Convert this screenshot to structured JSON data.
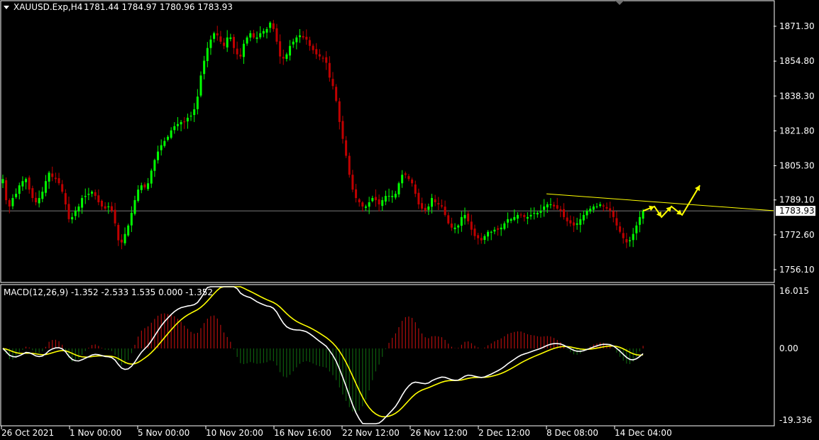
{
  "header": {
    "symbol": "XAUUSD.Exp,H4",
    "ohlc": "1781.44 1784.97 1780.96 1783.93"
  },
  "macd_header": "MACD(12,26,9) -1.352 -2.533 1.535 0.000 -1.352",
  "colors": {
    "background": "#000000",
    "bull": "#00ff00",
    "bear": "#c00000",
    "frame": "#ffffff",
    "trendline": "#ffff00",
    "macd_line": "#ffffff",
    "signal_line": "#ffff00",
    "hist_pos": "#d01010",
    "hist_neg": "#107010",
    "current_price_line": "#a0a0a0"
  },
  "icons": [
    "dropdown-triangle-icon",
    "scroll-marker-icon"
  ],
  "chart_data": [
    {
      "type": "candlestick",
      "title": "XAUUSD.Exp,H4",
      "y_ticks": [
        "1871.30",
        "1854.80",
        "1838.30",
        "1821.80",
        "1805.30",
        "1789.10",
        "1772.60",
        "1756.10"
      ],
      "ylim": [
        1752,
        1880
      ],
      "current_price": "1783.93",
      "x_ticks": [
        "26 Oct 2021",
        "1 Nov 00:00",
        "5 Nov 00:00",
        "10 Nov 20:00",
        "16 Nov 16:00",
        "22 Nov 12:00",
        "26 Nov 12:00",
        "2 Dec 12:00",
        "8 Dec 08:00",
        "14 Dec 04:00"
      ],
      "close_series": [
        1799,
        1789,
        1786,
        1790,
        1792,
        1796,
        1798,
        1799,
        1794,
        1790,
        1788,
        1790,
        1793,
        1798,
        1802,
        1800,
        1799,
        1797,
        1793,
        1787,
        1780,
        1781,
        1784,
        1786,
        1790,
        1791,
        1792,
        1793,
        1791,
        1788,
        1786,
        1785,
        1786,
        1784,
        1778,
        1770,
        1769,
        1773,
        1777,
        1783,
        1789,
        1794,
        1796,
        1795,
        1797,
        1803,
        1808,
        1812,
        1815,
        1817,
        1819,
        1822,
        1824,
        1825,
        1826,
        1826,
        1828,
        1829,
        1832,
        1838,
        1848,
        1855,
        1861,
        1865,
        1868,
        1867,
        1864,
        1862,
        1866,
        1866,
        1861,
        1858,
        1857,
        1863,
        1866,
        1868,
        1866,
        1866,
        1868,
        1869,
        1870,
        1873,
        1870,
        1864,
        1857,
        1856,
        1858,
        1862,
        1864,
        1866,
        1867,
        1866,
        1865,
        1862,
        1860,
        1858,
        1857,
        1856,
        1854,
        1847,
        1843,
        1836,
        1826,
        1818,
        1810,
        1801,
        1794,
        1790,
        1788,
        1786,
        1786,
        1788,
        1790,
        1789,
        1787,
        1789,
        1791,
        1791,
        1791,
        1792,
        1797,
        1801,
        1801,
        1799,
        1797,
        1792,
        1787,
        1785,
        1784,
        1786,
        1790,
        1788,
        1787,
        1786,
        1782,
        1778,
        1776,
        1776,
        1777,
        1781,
        1782,
        1779,
        1775,
        1772,
        1771,
        1770,
        1772,
        1774,
        1774,
        1775,
        1775,
        1776,
        1778,
        1780,
        1780,
        1781,
        1782,
        1782,
        1781,
        1781,
        1782,
        1783,
        1783,
        1784,
        1786,
        1787,
        1787,
        1786,
        1785,
        1784,
        1781,
        1779,
        1778,
        1777,
        1778,
        1780,
        1782,
        1784,
        1785,
        1786,
        1786,
        1787,
        1786,
        1785,
        1784,
        1781,
        1777,
        1774,
        1771,
        1769,
        1770,
        1773,
        1777,
        1781,
        1783.93
      ],
      "trendline": {
        "from": [
          0,
          1792
        ],
        "to": [
          1,
          1784
        ]
      },
      "projection": [
        1783.93,
        1786,
        1781,
        1786,
        1782,
        1796
      ]
    },
    {
      "type": "macd",
      "title": "MACD(12,26,9)",
      "y_ticks": [
        "16.015",
        "0.00",
        "-19.336"
      ],
      "ylim": [
        -19.336,
        16.015
      ],
      "values": {
        "main": -1.352,
        "signal": -2.533,
        "histogram": 1.535,
        "zero": 0.0,
        "last": -1.352
      }
    }
  ]
}
